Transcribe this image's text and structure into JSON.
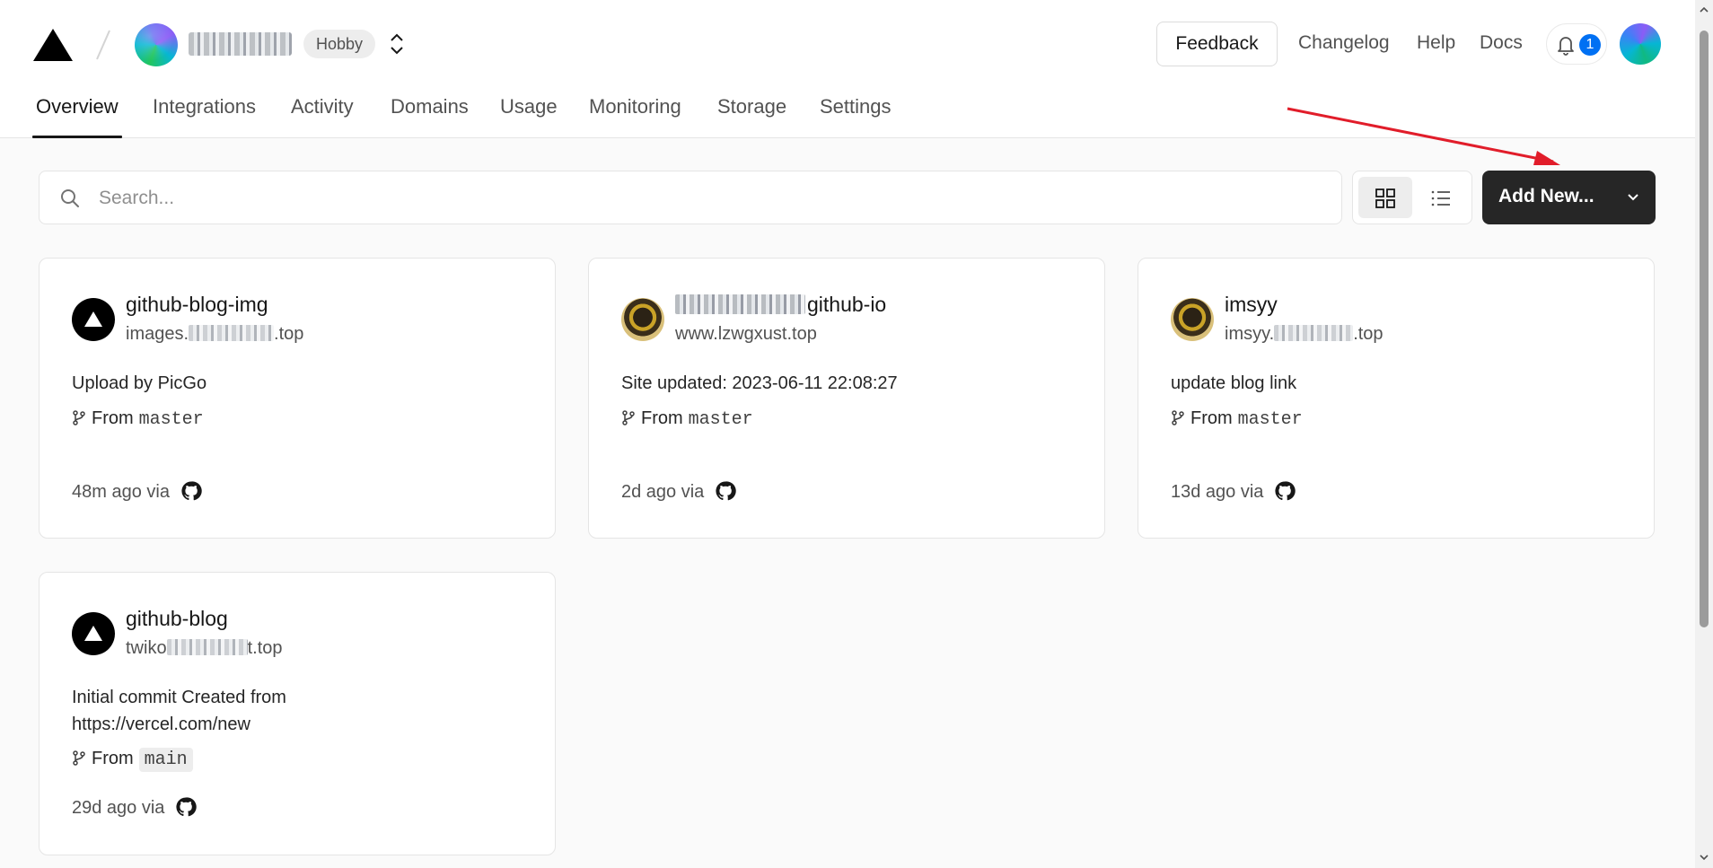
{
  "header": {
    "team_name": "▬▬▬▬▬▬▬",
    "plan_badge": "Hobby",
    "feedback_label": "Feedback",
    "links": {
      "changelog": "Changelog",
      "help": "Help",
      "docs": "Docs"
    },
    "notifications_count": "1"
  },
  "tabs": [
    {
      "label": "Overview",
      "active": true
    },
    {
      "label": "Integrations"
    },
    {
      "label": "Activity"
    },
    {
      "label": "Domains"
    },
    {
      "label": "Usage"
    },
    {
      "label": "Monitoring"
    },
    {
      "label": "Storage"
    },
    {
      "label": "Settings"
    }
  ],
  "toolbar": {
    "search_placeholder": "Search...",
    "search_value": "",
    "view_mode": "grid",
    "add_new_label": "Add New..."
  },
  "projects": [
    {
      "name": "github-blog-img",
      "domain_prefix": "images.",
      "domain_suffix": ".top",
      "commit": "Upload by PicGo",
      "branch_prefix": "From",
      "branch": "master",
      "time": "48m ago via",
      "avatar": "vercel-triangle-icon"
    },
    {
      "name_suffix": "github-io",
      "domain": "www.lzwgxust.top",
      "commit": "Site updated: 2023-06-11 22:08:27",
      "branch_prefix": "From",
      "branch": "master",
      "time": "2d ago via",
      "avatar": "character-avatar"
    },
    {
      "name": "imsyy",
      "domain_prefix": "imsyy.",
      "domain_suffix": ".top",
      "commit": "update blog link",
      "branch_prefix": "From",
      "branch": "master",
      "time": "13d ago via",
      "avatar": "character-avatar"
    },
    {
      "name": "github-blog",
      "domain_prefix": "twiko",
      "domain_suffix": "t.top",
      "commit": "Initial commit Created from https://vercel.com/new",
      "branch_prefix": "From",
      "branch": "main",
      "time": "29d ago via",
      "avatar": "vercel-triangle-icon"
    }
  ],
  "colors": {
    "accent_dark": "#262626",
    "notification_blue": "#0070f3",
    "annotation_red": "#e11d2a",
    "page_background": "#fafafa"
  }
}
